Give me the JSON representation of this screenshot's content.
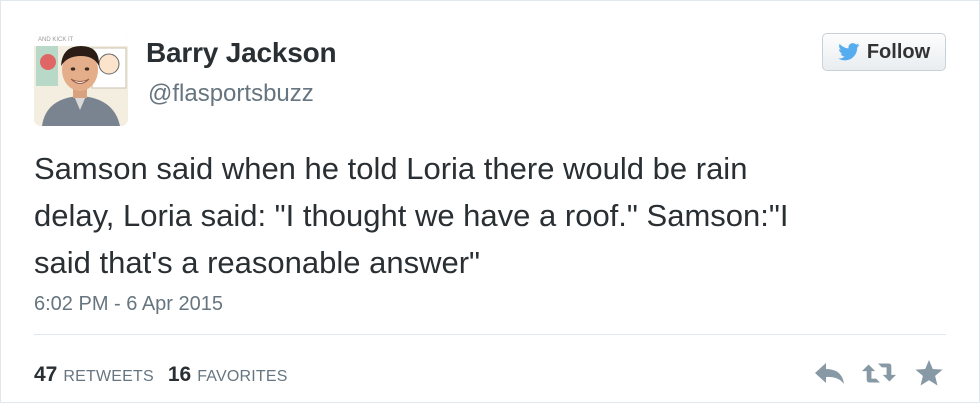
{
  "tweet": {
    "author": {
      "display_name": "Barry Jackson",
      "handle": "@flasportsbuzz",
      "avatar_icon": "user-avatar"
    },
    "follow_button": {
      "label": "Follow",
      "icon": "twitter-bird-icon",
      "bird_color": "#55acee"
    },
    "text_lines": [
      "Samson said when he told Loria there would be rain",
      "delay, Loria said: \"I thought we have a roof.\" Samson:\"I",
      "said that's a reasonable answer\""
    ],
    "timestamp": "6:02 PM - 6 Apr 2015",
    "stats": {
      "retweets_count": "47",
      "retweets_label": "RETWEETS",
      "favorites_count": "16",
      "favorites_label": "FAVORITES"
    },
    "actions": [
      {
        "name": "reply",
        "icon": "reply-icon"
      },
      {
        "name": "retweet",
        "icon": "retweet-icon"
      },
      {
        "name": "favorite",
        "icon": "star-icon"
      }
    ],
    "icon_color": "#8899a6"
  }
}
